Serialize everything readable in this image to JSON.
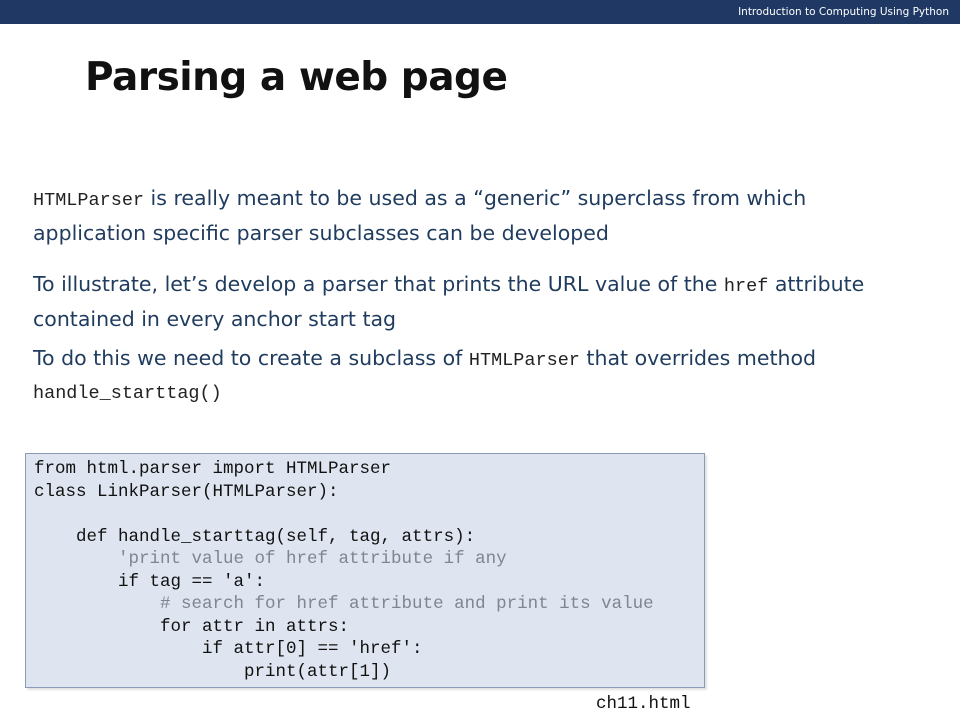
{
  "header": {
    "course_title": "Introduction to Computing Using Python",
    "bar_color": "#1f3864"
  },
  "slide_title": "Parsing a web page",
  "paragraphs": {
    "p1": {
      "code1": "HTMLParser",
      "text1": " is really meant to be used as a “generic” superclass from which",
      "line2": "application specific parser subclasses can be developed"
    },
    "p2": {
      "text1": "To illustrate, let’s develop a parser that prints the URL value of the ",
      "code1": "href",
      "text2": " attribute",
      "line2": "contained in every anchor start tag"
    },
    "p3": {
      "text1": "To do this we need to create a subclass of ",
      "code1": "HTMLParser",
      "text2": " that overrides method",
      "code2": "handle_starttag()"
    }
  },
  "code_block": {
    "lines": [
      "from html.parser import HTMLParser",
      "class LinkParser(HTMLParser):",
      "",
      "    def handle_starttag(self, tag, attrs):",
      "        'print value of href attribute if any",
      "        if tag == 'a':",
      "            # search for href attribute and print its value",
      "            for attr in attrs:",
      "                if attr[0] == 'href':",
      "                    print(attr[1])"
    ],
    "comment_lines": [
      4,
      6
    ]
  },
  "filename": "ch11.html"
}
